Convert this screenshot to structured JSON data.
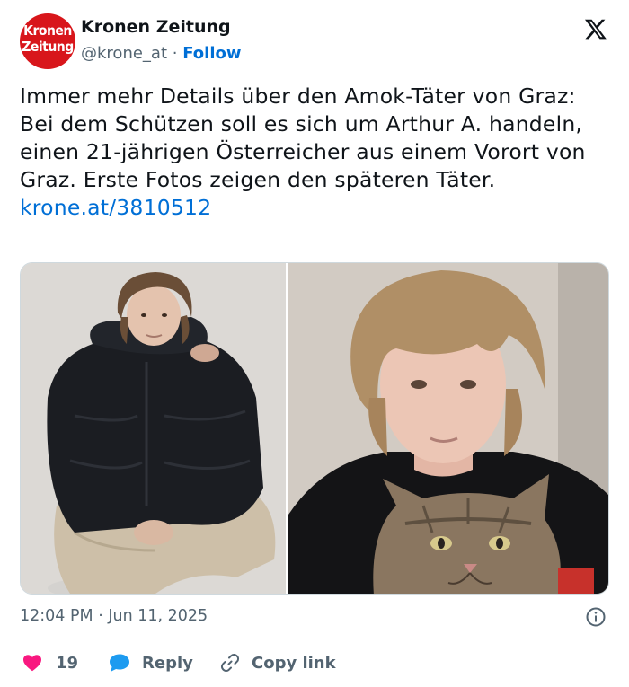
{
  "author": {
    "name": "Kronen Zeitung",
    "handle": "@krone_at",
    "separator": "·",
    "follow_label": "Follow",
    "avatar_logo": {
      "line1": "Kronen",
      "line2": "Zeitung"
    },
    "avatar_color": "#d8161b"
  },
  "platform_icon": "x-logo-icon",
  "tweet": {
    "text": "Immer mehr Details über den Amok-Täter von Graz: Bei dem Schützen soll es sich um Arthur A. handeln, einen 21-jährigen Österreicher aus einem Vorort von Graz. Erste Fotos zeigen den späteren Täter.",
    "link": "krone.at/3810512"
  },
  "media": {
    "count": 2
  },
  "timestamp": "12:04 PM · Jun 11, 2025",
  "actions": {
    "likes": "19",
    "reply_label": "Reply",
    "copy_label": "Copy link"
  },
  "colors": {
    "accent": "#006fd6",
    "like": "#f91880",
    "reply": "#1d9bf0",
    "muted": "#536471"
  }
}
